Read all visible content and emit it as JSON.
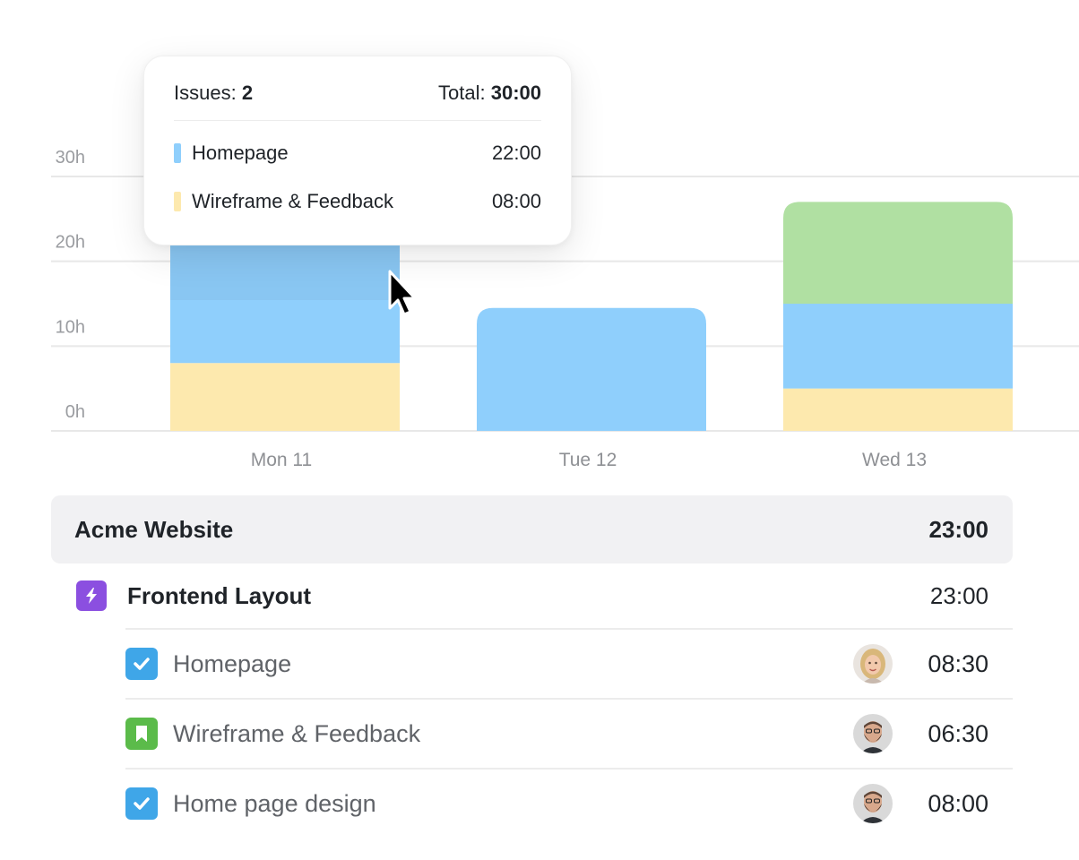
{
  "chart_data": {
    "type": "bar",
    "stacked": true,
    "categories": [
      "Mon 11",
      "Tue 12",
      "Wed 13"
    ],
    "series": [
      {
        "name": "Wireframe & Feedback",
        "color": "#fde9ae",
        "values": [
          8,
          0,
          5
        ]
      },
      {
        "name": "Homepage",
        "color": "#8fcffc",
        "values": [
          22,
          14.5,
          10
        ]
      },
      {
        "name": "",
        "color": "#b0e0a2",
        "values": [
          0,
          0,
          12
        ]
      }
    ],
    "y_ticks": [
      "0h",
      "10h",
      "20h",
      "30h"
    ],
    "ylim": [
      0,
      30
    ]
  },
  "tooltip": {
    "issues_label": "Issues:",
    "issues_value": "2",
    "total_label": "Total:",
    "total_value": "30:00",
    "rows": [
      {
        "label": "Homepage",
        "time": "22:00",
        "color": "#8fcffc"
      },
      {
        "label": "Wireframe & Feedback",
        "time": "08:00",
        "color": "#fde9ae"
      }
    ]
  },
  "group": {
    "title": "Acme Website",
    "total": "23:00"
  },
  "epic": {
    "title": "Frontend Layout",
    "total": "23:00",
    "icon": "bolt-icon"
  },
  "tasks": [
    {
      "title": "Homepage",
      "time": "08:30",
      "icon": "checkbox-icon",
      "icon_color": "#3fa6e8",
      "avatar": "woman-avatar"
    },
    {
      "title": "Wireframe & Feedback",
      "time": "06:30",
      "icon": "bookmark-icon",
      "icon_color": "#5bbb4a",
      "avatar": "man-avatar"
    },
    {
      "title": "Home page design",
      "time": "08:00",
      "icon": "checkbox-icon",
      "icon_color": "#3fa6e8",
      "avatar": "man-avatar"
    }
  ]
}
